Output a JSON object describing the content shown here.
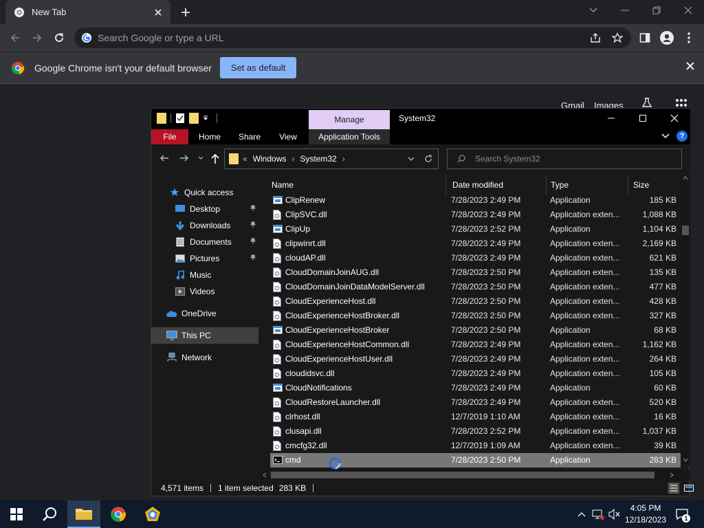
{
  "chrome": {
    "tab_title": "New Tab",
    "omnibox_placeholder": "Search Google or type a URL",
    "infobar_message": "Google Chrome isn't your default browser",
    "infobar_button": "Set as default",
    "ntp_links": [
      "Gmail",
      "Images"
    ]
  },
  "explorer": {
    "title": "System32",
    "manage_tab": "Manage",
    "ribbon_tabs": [
      "File",
      "Home",
      "Share",
      "View",
      "Application Tools"
    ],
    "breadcrumb": [
      "Windows",
      "System32"
    ],
    "breadcrumb_overflow": "«",
    "search_placeholder": "Search System32",
    "help": "?",
    "nav": {
      "quick_access": "Quick access",
      "desktop": "Desktop",
      "downloads": "Downloads",
      "documents": "Documents",
      "pictures": "Pictures",
      "music": "Music",
      "videos": "Videos",
      "onedrive": "OneDrive",
      "this_pc": "This PC",
      "network": "Network"
    },
    "columns": {
      "name": "Name",
      "date": "Date modified",
      "type": "Type",
      "size": "Size"
    },
    "files": [
      {
        "name": "ClipRenew",
        "date": "7/28/2023 2:49 PM",
        "type": "Application",
        "size": "185 KB",
        "icon": "app"
      },
      {
        "name": "ClipSVC.dll",
        "date": "7/28/2023 2:49 PM",
        "type": "Application exten...",
        "size": "1,088 KB",
        "icon": "dll"
      },
      {
        "name": "ClipUp",
        "date": "7/28/2023 2:52 PM",
        "type": "Application",
        "size": "1,104 KB",
        "icon": "app"
      },
      {
        "name": "clipwinrt.dll",
        "date": "7/28/2023 2:49 PM",
        "type": "Application exten...",
        "size": "2,169 KB",
        "icon": "dll"
      },
      {
        "name": "cloudAP.dll",
        "date": "7/28/2023 2:49 PM",
        "type": "Application exten...",
        "size": "621 KB",
        "icon": "dll"
      },
      {
        "name": "CloudDomainJoinAUG.dll",
        "date": "7/28/2023 2:50 PM",
        "type": "Application exten...",
        "size": "135 KB",
        "icon": "dll"
      },
      {
        "name": "CloudDomainJoinDataModelServer.dll",
        "date": "7/28/2023 2:50 PM",
        "type": "Application exten...",
        "size": "477 KB",
        "icon": "dll"
      },
      {
        "name": "CloudExperienceHost.dll",
        "date": "7/28/2023 2:50 PM",
        "type": "Application exten...",
        "size": "428 KB",
        "icon": "dll"
      },
      {
        "name": "CloudExperienceHostBroker.dll",
        "date": "7/28/2023 2:50 PM",
        "type": "Application exten...",
        "size": "327 KB",
        "icon": "dll"
      },
      {
        "name": "CloudExperienceHostBroker",
        "date": "7/28/2023 2:50 PM",
        "type": "Application",
        "size": "68 KB",
        "icon": "app"
      },
      {
        "name": "CloudExperienceHostCommon.dll",
        "date": "7/28/2023 2:49 PM",
        "type": "Application exten...",
        "size": "1,162 KB",
        "icon": "dll"
      },
      {
        "name": "CloudExperienceHostUser.dll",
        "date": "7/28/2023 2:49 PM",
        "type": "Application exten...",
        "size": "264 KB",
        "icon": "dll"
      },
      {
        "name": "cloudidsvc.dll",
        "date": "7/28/2023 2:49 PM",
        "type": "Application exten...",
        "size": "105 KB",
        "icon": "dll"
      },
      {
        "name": "CloudNotifications",
        "date": "7/28/2023 2:49 PM",
        "type": "Application",
        "size": "60 KB",
        "icon": "app"
      },
      {
        "name": "CloudRestoreLauncher.dll",
        "date": "7/28/2023 2:49 PM",
        "type": "Application exten...",
        "size": "520 KB",
        "icon": "dll"
      },
      {
        "name": "clrhost.dll",
        "date": "12/7/2019 1:10 AM",
        "type": "Application exten...",
        "size": "16 KB",
        "icon": "dll"
      },
      {
        "name": "clusapi.dll",
        "date": "7/28/2023 2:52 PM",
        "type": "Application exten...",
        "size": "1,037 KB",
        "icon": "dll"
      },
      {
        "name": "cmcfg32.dll",
        "date": "12/7/2019 1:09 AM",
        "type": "Application exten...",
        "size": "39 KB",
        "icon": "dll"
      },
      {
        "name": "cmd",
        "date": "7/28/2023 2:50 PM",
        "type": "Application",
        "size": "283 KB",
        "icon": "cmd",
        "selected": true
      }
    ],
    "status": {
      "items": "4,571 items",
      "selected": "1 item selected",
      "size": "283 KB"
    }
  },
  "taskbar": {
    "time": "4:05 PM",
    "date": "12/18/2023",
    "notification_count": "1"
  }
}
